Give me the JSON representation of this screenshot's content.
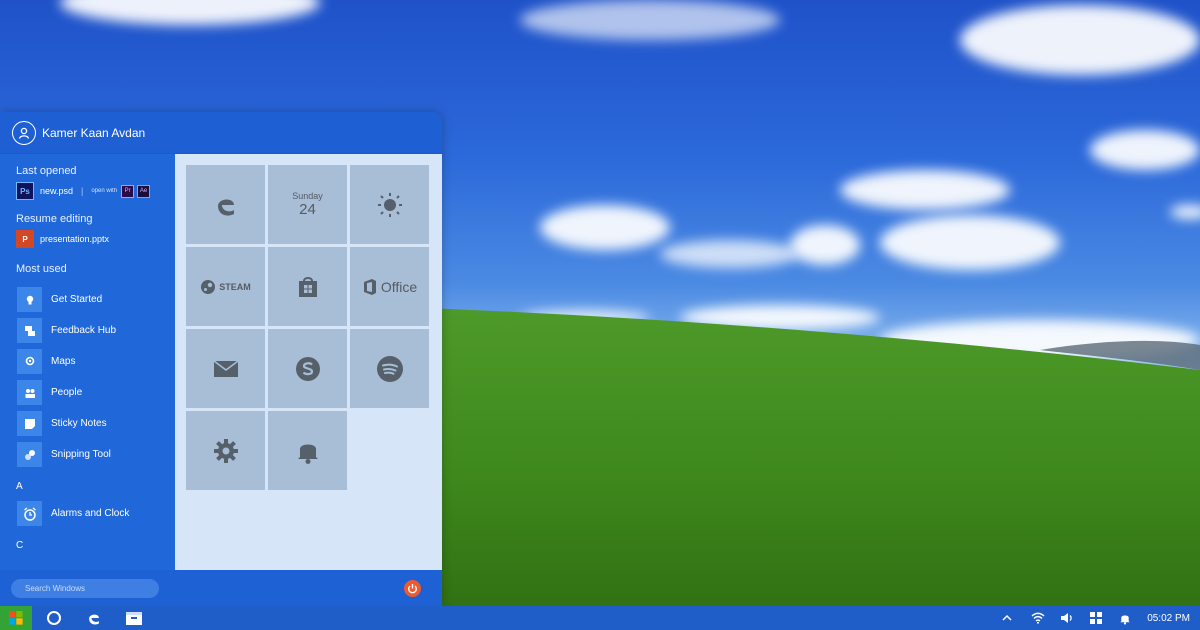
{
  "user": {
    "name": "Kamer Kaan Avdan"
  },
  "recent": {
    "last_opened_label": "Last opened",
    "last_opened_file": "new.psd",
    "open_with_label": "open with",
    "open_with_apps": [
      "Pr",
      "Ae"
    ],
    "file_badge_ps": "Ps",
    "resume_label": "Resume editing",
    "resume_file": "presentation.pptx",
    "file_badge_p": "P"
  },
  "most_used": {
    "label": "Most used",
    "apps": [
      {
        "name": "Get Started",
        "icon": "lightbulb-icon"
      },
      {
        "name": "Feedback Hub",
        "icon": "feedback-icon"
      },
      {
        "name": "Maps",
        "icon": "map-pin-icon"
      },
      {
        "name": "People",
        "icon": "people-icon"
      },
      {
        "name": "Sticky Notes",
        "icon": "sticky-note-icon"
      },
      {
        "name": "Snipping Tool",
        "icon": "scissors-icon"
      }
    ]
  },
  "alpha": {
    "a_letter": "A",
    "a_apps": [
      {
        "name": "Alarms and Clock",
        "icon": "alarm-clock-icon"
      }
    ],
    "c_letter": "C"
  },
  "tiles": {
    "calendar_day": "Sunday",
    "calendar_date": "24",
    "steam_label": "STEAM",
    "office_label": "Office"
  },
  "search": {
    "placeholder": "Search Windows"
  },
  "taskbar": {
    "time": "05:02 PM"
  },
  "colors": {
    "menu_blue": "#1f63d6",
    "tile_bg": "#a8bdd6",
    "tiles_area": "#d6e5f8",
    "power_orange": "#f0592b",
    "start_green": "#32a334",
    "taskbar": "#1f5ec9"
  }
}
